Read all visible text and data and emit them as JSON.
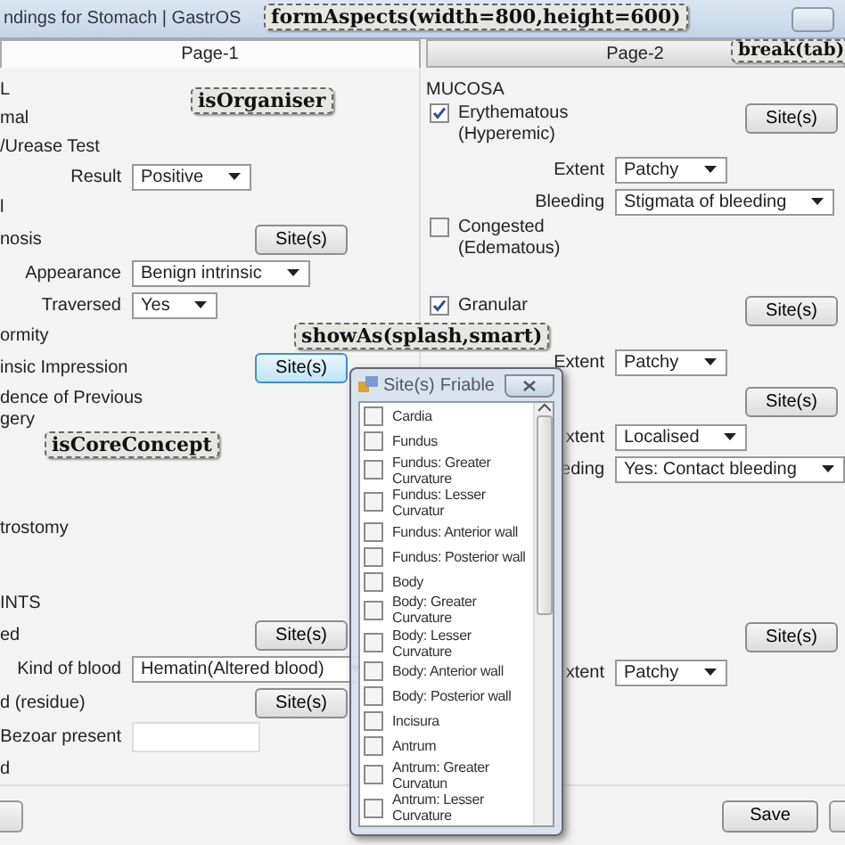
{
  "window": {
    "title": "ndings for Stomach | GastrOS"
  },
  "tabs": [
    {
      "label": "Page-1",
      "selected": true
    },
    {
      "label": "Page-2",
      "selected": false
    }
  ],
  "annotations": [
    "formAspects(width=800,height=600)",
    "break(tab)",
    "isOrganiser",
    "showAs(splash,smart)",
    "isCoreConcept"
  ],
  "left_rows": [
    {
      "kind": "heading",
      "label": "L"
    },
    {
      "kind": "text",
      "label": "mal"
    },
    {
      "kind": "text",
      "label": "/Urease Test"
    },
    {
      "kind": "select",
      "label": "Result",
      "value": "Positive"
    },
    {
      "kind": "text",
      "label": "l"
    },
    {
      "kind": "label_button",
      "label": "nosis",
      "button": "Site(s)",
      "focused": false
    },
    {
      "kind": "select",
      "label": "Appearance",
      "value": "Benign intrinsic"
    },
    {
      "kind": "select",
      "label": "Traversed",
      "value": "Yes"
    },
    {
      "kind": "text",
      "label": "ormity"
    },
    {
      "kind": "label_button",
      "label": "insic Impression",
      "button": "Site(s)",
      "focused": true
    },
    {
      "kind": "wrap_text",
      "label": "dence of Previous gery"
    },
    {
      "kind": "text",
      "label": "trostomy"
    },
    {
      "kind": "heading",
      "label": "INTS"
    },
    {
      "kind": "label_button",
      "label": "ed",
      "button": "Site(s)",
      "focused": false
    },
    {
      "kind": "select",
      "label": "Kind of blood",
      "value": "Hematin(Altered blood)"
    },
    {
      "kind": "label_button",
      "label": "d (residue)",
      "button": "Site(s)",
      "focused": false
    },
    {
      "kind": "input",
      "label": "Bezoar present"
    },
    {
      "kind": "text",
      "label": "d"
    }
  ],
  "right_rows": [
    {
      "kind": "heading",
      "label": "MUCOSA"
    },
    {
      "kind": "check",
      "label": "Erythematous (Hyperemic)",
      "checked": true,
      "button": "Site(s)"
    },
    {
      "kind": "select",
      "label": "Extent",
      "value": "Patchy"
    },
    {
      "kind": "select",
      "label": "Bleeding",
      "value": "Stigmata of bleeding"
    },
    {
      "kind": "check",
      "label": "Congested (Edematous)",
      "checked": false
    },
    {
      "kind": "check",
      "label": "Granular",
      "checked": true,
      "button": "Site(s)"
    },
    {
      "kind": "select",
      "label": "Extent",
      "value": "Patchy"
    },
    {
      "kind": "button",
      "button": "Site(s)"
    },
    {
      "kind": "select",
      "label": "xtent",
      "value": "Localised"
    },
    {
      "kind": "select",
      "label": "eding",
      "value": "Yes: Contact bleeding"
    },
    {
      "kind": "button",
      "button": "Site(s)"
    },
    {
      "kind": "select",
      "label": "xtent",
      "value": "Patchy"
    }
  ],
  "footer": {
    "save": "Save"
  },
  "popup": {
    "title": "Site(s)",
    "behind_label": "Friable",
    "items": [
      {
        "label": "Cardia",
        "checked": false
      },
      {
        "label": "Fundus",
        "checked": false
      },
      {
        "label": "Fundus: Greater Curvature",
        "checked": false
      },
      {
        "label": "Fundus: Lesser Curvatur",
        "checked": false
      },
      {
        "label": "Fundus: Anterior wall",
        "checked": false
      },
      {
        "label": "Fundus: Posterior wall",
        "checked": false
      },
      {
        "label": "Body",
        "checked": false
      },
      {
        "label": "Body: Greater Curvature",
        "checked": false
      },
      {
        "label": "Body: Lesser Curvature",
        "checked": false
      },
      {
        "label": "Body: Anterior wall",
        "checked": false
      },
      {
        "label": "Body: Posterior wall",
        "checked": false
      },
      {
        "label": "Incisura",
        "checked": false
      },
      {
        "label": "Antrum",
        "checked": false
      },
      {
        "label": "Antrum: Greater Curvatun",
        "checked": false
      },
      {
        "label": "Antrum: Lesser Curvature",
        "checked": false
      }
    ]
  }
}
